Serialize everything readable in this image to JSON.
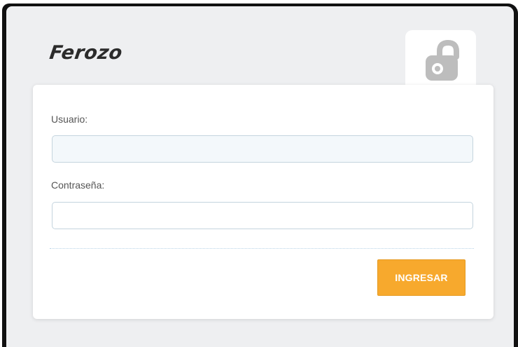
{
  "brand": {
    "name": "Ferozo"
  },
  "login": {
    "user_label": "Usuario:",
    "user_value": "",
    "password_label": "Contraseña:",
    "password_value": "",
    "submit_label": "INGRESAR"
  },
  "colors": {
    "accent": "#f7a92d",
    "panel_bg": "#eeeff1",
    "frame": "#111111",
    "icon": "#bdbdbd"
  },
  "icons": {
    "lock": "lock-icon"
  }
}
